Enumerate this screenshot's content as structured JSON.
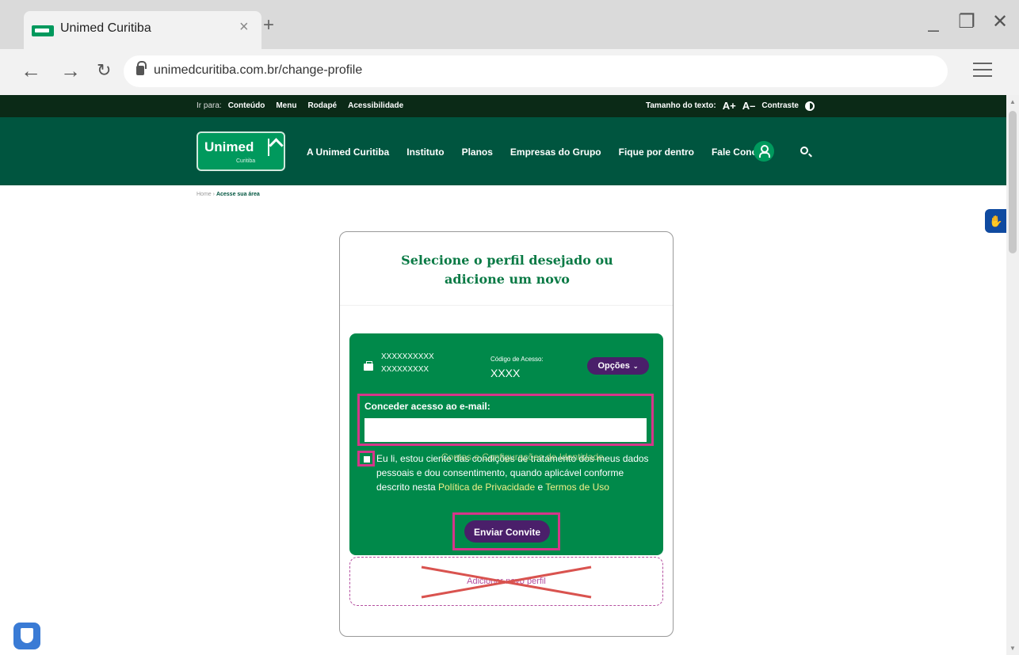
{
  "browser": {
    "tab_title": "Unimed Curitiba",
    "url": "unimedcuritiba.com.br/change-profile"
  },
  "topbar": {
    "goto_label": "Ir para:",
    "links": [
      "Conteúdo",
      "Menu",
      "Rodapé",
      "Acessibilidade"
    ],
    "text_size_label": "Tamanho do texto:",
    "increase": "A+",
    "decrease": "A–",
    "contrast": "Contraste"
  },
  "header": {
    "logo_text": "Unimed",
    "logo_sub": "Curitiba",
    "nav": [
      "A Unimed Curitiba",
      "Instituto",
      "Planos",
      "Empresas do Grupo",
      "Fique por dentro",
      "Fale Conosco"
    ]
  },
  "breadcrumb": {
    "home": "Home",
    "separator": "›",
    "current": "Acesse sua área"
  },
  "card": {
    "title_line1": "Selecione o perfil desejado ou",
    "title_line2": "adicione um novo",
    "profile": {
      "name_line1": "XXXXXXXXXX",
      "name_line2": "XXXXXXXXX",
      "code_label": "Código de Acesso:",
      "code_value": "XXXX",
      "options_label": "Opções"
    },
    "email": {
      "label": "Conceder acesso ao e-mail:",
      "value": "",
      "placeholder": ""
    },
    "terms": {
      "text_a": "Eu li, estou ciente das condições de tratamento dos meus dados pessoais e dou consentimento, quando aplicável conforme descrito nesta ",
      "privacy": "Política de Privacidade",
      "and": " e ",
      "terms_link": "Termos de Uso",
      "ghost_overlay": "Contas e Configurações de Identidade"
    },
    "send_label": "Enviar Convite",
    "add_profile_label": "Adicionar novo perfil"
  },
  "colors": {
    "dark_green": "#00553f",
    "brand_green": "#00894a",
    "purple": "#4a1f6a",
    "highlight": "#d6368a"
  }
}
